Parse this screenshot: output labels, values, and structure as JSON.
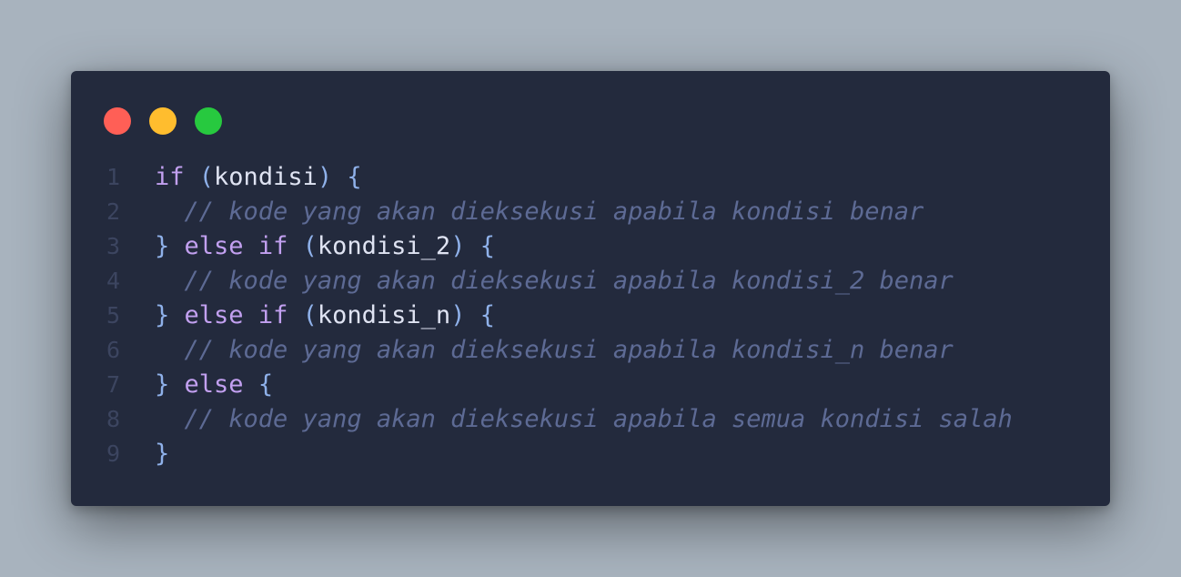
{
  "window": {
    "traffic_lights": [
      {
        "name": "close",
        "color": "#ff5f56"
      },
      {
        "name": "minimize",
        "color": "#ffbd2e"
      },
      {
        "name": "zoom",
        "color": "#27c93f"
      }
    ]
  },
  "colors": {
    "background": "#a8b3be",
    "editor_bg": "#232a3d",
    "keyword": "#c2a0f0",
    "punctuation": "#8fb1ea",
    "identifier": "#dfe3f2",
    "comment": "#5d6a94",
    "line_number": "#3c4560"
  },
  "code": {
    "lines": [
      {
        "number": "1",
        "tokens": [
          {
            "t": "kw",
            "v": "if"
          },
          {
            "t": "id",
            "v": " "
          },
          {
            "t": "p",
            "v": "("
          },
          {
            "t": "id",
            "v": "kondisi"
          },
          {
            "t": "p",
            "v": ")"
          },
          {
            "t": "id",
            "v": " "
          },
          {
            "t": "p",
            "v": "{"
          }
        ]
      },
      {
        "number": "2",
        "tokens": [
          {
            "t": "id",
            "v": "  "
          },
          {
            "t": "c",
            "v": "// kode yang akan dieksekusi apabila kondisi benar"
          }
        ]
      },
      {
        "number": "3",
        "tokens": [
          {
            "t": "p",
            "v": "}"
          },
          {
            "t": "id",
            "v": " "
          },
          {
            "t": "kw",
            "v": "else"
          },
          {
            "t": "id",
            "v": " "
          },
          {
            "t": "kw",
            "v": "if"
          },
          {
            "t": "id",
            "v": " "
          },
          {
            "t": "p",
            "v": "("
          },
          {
            "t": "id",
            "v": "kondisi_2"
          },
          {
            "t": "p",
            "v": ")"
          },
          {
            "t": "id",
            "v": " "
          },
          {
            "t": "p",
            "v": "{"
          }
        ]
      },
      {
        "number": "4",
        "tokens": [
          {
            "t": "id",
            "v": "  "
          },
          {
            "t": "c",
            "v": "// kode yang akan dieksekusi apabila kondisi_2 benar"
          }
        ]
      },
      {
        "number": "5",
        "tokens": [
          {
            "t": "p",
            "v": "}"
          },
          {
            "t": "id",
            "v": " "
          },
          {
            "t": "kw",
            "v": "else"
          },
          {
            "t": "id",
            "v": " "
          },
          {
            "t": "kw",
            "v": "if"
          },
          {
            "t": "id",
            "v": " "
          },
          {
            "t": "p",
            "v": "("
          },
          {
            "t": "id",
            "v": "kondisi_n"
          },
          {
            "t": "p",
            "v": ")"
          },
          {
            "t": "id",
            "v": " "
          },
          {
            "t": "p",
            "v": "{"
          }
        ]
      },
      {
        "number": "6",
        "tokens": [
          {
            "t": "id",
            "v": "  "
          },
          {
            "t": "c",
            "v": "// kode yang akan dieksekusi apabila kondisi_n benar"
          }
        ]
      },
      {
        "number": "7",
        "tokens": [
          {
            "t": "p",
            "v": "}"
          },
          {
            "t": "id",
            "v": " "
          },
          {
            "t": "kw",
            "v": "else"
          },
          {
            "t": "id",
            "v": " "
          },
          {
            "t": "p",
            "v": "{"
          }
        ]
      },
      {
        "number": "8",
        "tokens": [
          {
            "t": "id",
            "v": "  "
          },
          {
            "t": "c",
            "v": "// kode yang akan dieksekusi apabila semua kondisi salah"
          }
        ]
      },
      {
        "number": "9",
        "tokens": [
          {
            "t": "p",
            "v": "}"
          }
        ]
      }
    ]
  }
}
